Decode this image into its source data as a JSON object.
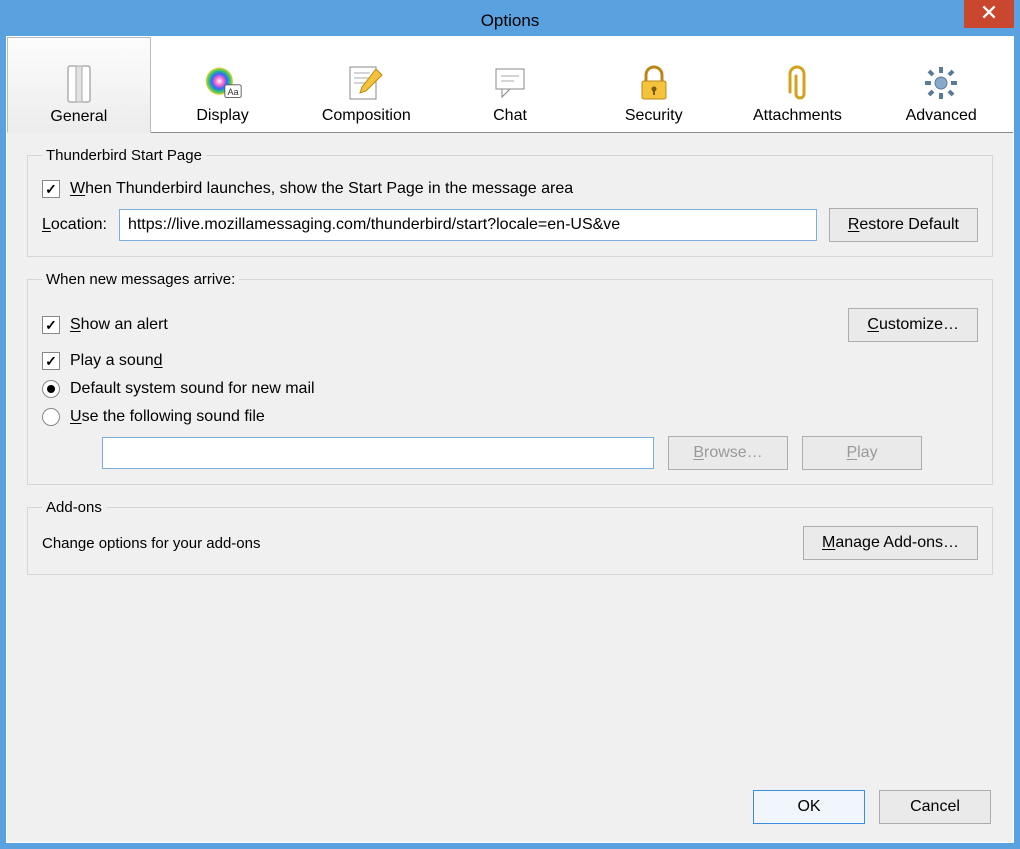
{
  "window": {
    "title": "Options"
  },
  "tabs": {
    "general": {
      "label": "General"
    },
    "display": {
      "label": "Display"
    },
    "composition": {
      "label": "Composition"
    },
    "chat": {
      "label": "Chat"
    },
    "security": {
      "label": "Security"
    },
    "attachments": {
      "label": "Attachments"
    },
    "advanced": {
      "label": "Advanced"
    }
  },
  "startpage": {
    "legend": "Thunderbird Start Page",
    "checkbox_label_pre": "W",
    "checkbox_label_post": "hen Thunderbird launches, show the Start Page in the message area",
    "location_label_pre": "L",
    "location_label_post": "ocation:",
    "location_value": "https://live.mozillamessaging.com/thunderbird/start?locale=en-US&ve",
    "restore_pre": "R",
    "restore_post": "estore Default"
  },
  "newmsg": {
    "legend": "When new messages arrive:",
    "alert_pre": "S",
    "alert_post": "how an alert",
    "customize_pre": "C",
    "customize_post": "ustomize…",
    "play_pre": "Play a soun",
    "play_u": "d",
    "radio_default": "Default system sound for new mail",
    "radio_file_pre": "U",
    "radio_file_post": "se the following sound file",
    "soundfile_value": "",
    "browse_pre": "B",
    "browse_post": "rowse…",
    "playbtn_pre": "P",
    "playbtn_post": "lay"
  },
  "addons": {
    "legend": "Add-ons",
    "desc": "Change options for your add-ons",
    "manage_pre": "M",
    "manage_post": "anage Add-ons…"
  },
  "footer": {
    "ok": "OK",
    "cancel": "Cancel"
  }
}
